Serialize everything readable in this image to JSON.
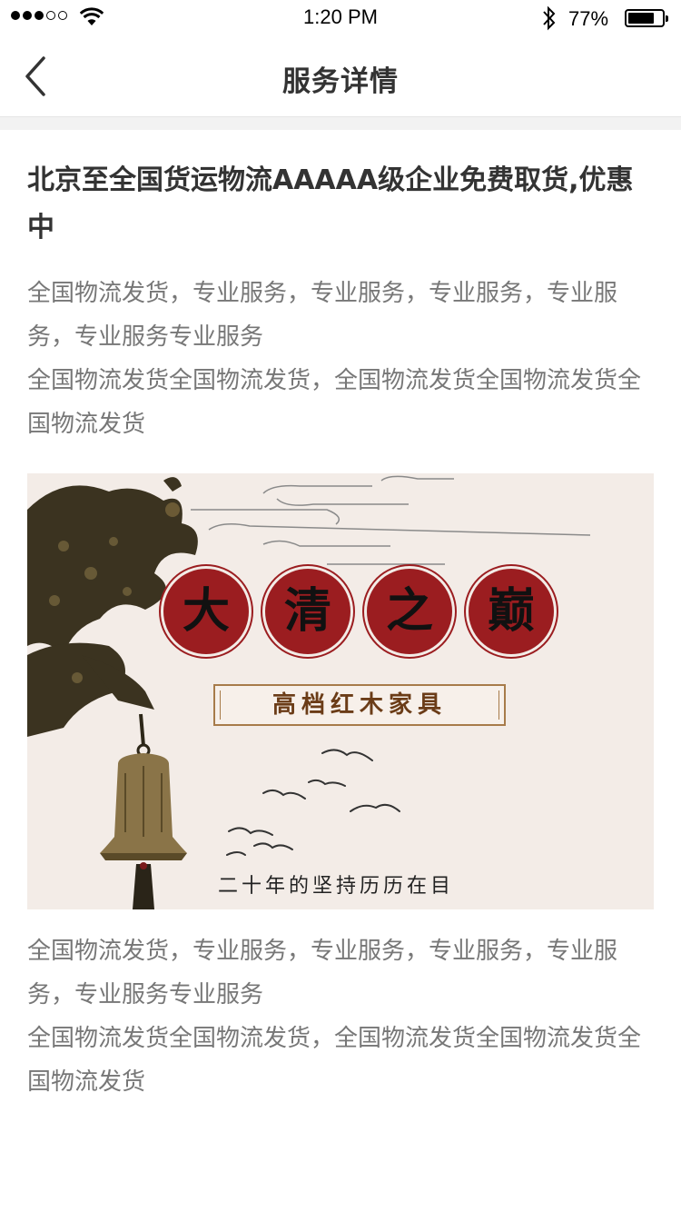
{
  "status_bar": {
    "time": "1:20 PM",
    "battery_percent": "77%",
    "battery_level": 0.77,
    "signal_bars_filled": 3,
    "signal_bars_total": 5
  },
  "nav": {
    "title": "服务详情",
    "back_icon": "chevron-left-icon"
  },
  "article": {
    "title": "北京至全国货运物流AAAAA级企业免费取货,优惠中",
    "intro_paragraphs": [
      "全国物流发货，专业服务，专业服务，专业服务，专业服务，专业服务专业服务",
      "全国物流发货全国物流发货，全国物流发货全国物流发货全国物流发货"
    ],
    "banner": {
      "seals": [
        "大",
        "清",
        "之",
        "巅"
      ],
      "plaque": "高档红木家具",
      "motto": "二十年的坚持历历在目"
    },
    "outro_paragraphs": [
      "全国物流发货，专业服务，专业服务，专业服务，专业服务，专业服务专业服务",
      "全国物流发货全国物流发货，全国物流发货全国物流发货全国物流发货"
    ]
  }
}
